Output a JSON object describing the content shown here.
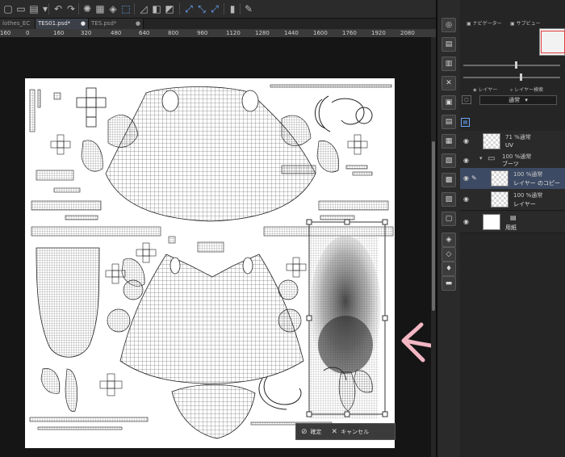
{
  "tabs": [
    {
      "label": "lothes_EC",
      "active": false
    },
    {
      "label": "TES01.psd*",
      "active": true
    },
    {
      "label": "TES.psd*",
      "active": false
    }
  ],
  "ruler": {
    "ticks": [
      "160",
      "0",
      "160",
      "320",
      "480",
      "640",
      "800",
      "960",
      "1120",
      "1280",
      "1440",
      "1600",
      "1760",
      "1920",
      "2080"
    ]
  },
  "transform": {
    "confirm_label": "確定",
    "cancel_label": "キャンセル"
  },
  "panel": {
    "tabs": {
      "navigator": "ナビゲーター",
      "sub1": "サブビュー",
      "layer": "レイヤー",
      "layer_search": "レイヤー検索"
    },
    "blend_mode": "通常"
  },
  "layers": [
    {
      "meta": "71 %通常",
      "name": "UV",
      "selected": false,
      "thumb": "checker"
    },
    {
      "meta": "100 %通常",
      "name": "ブーツ",
      "selected": false,
      "folder": true
    },
    {
      "meta": "100 %通常",
      "name": "レイヤー のコピー",
      "selected": true,
      "thumb": "checker"
    },
    {
      "meta": "100 %通常",
      "name": "レイヤー",
      "selected": false,
      "thumb": "checker"
    },
    {
      "meta": "",
      "name": "用紙",
      "selected": false,
      "thumb": "white"
    }
  ],
  "colors": {
    "accent": "#6aa9ff",
    "selection": "#3d4a63",
    "navigator_frame": "#e23b3b",
    "arrow_annotation": "#f3b7c4"
  }
}
